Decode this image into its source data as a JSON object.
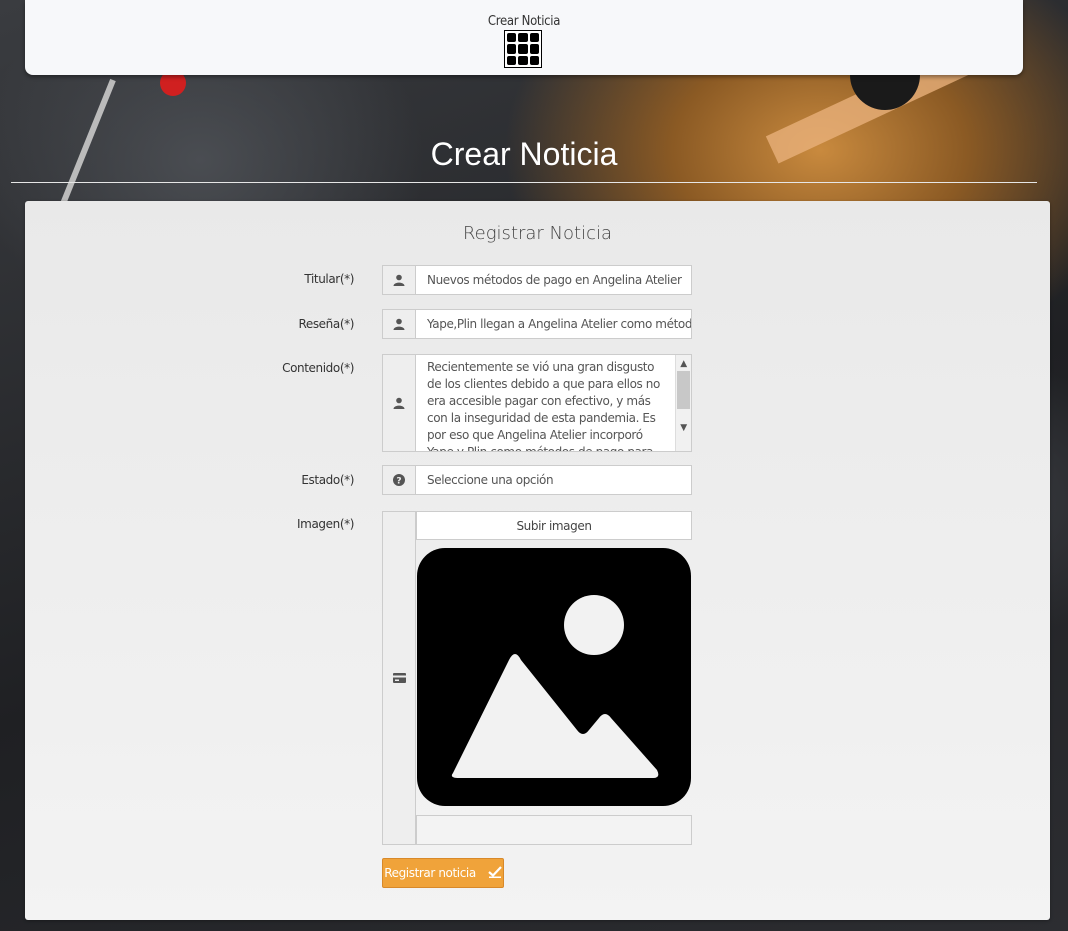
{
  "header": {
    "menu_title": "Crear Noticia",
    "menu_icon": "grid-icon"
  },
  "page": {
    "title": "Crear Noticia"
  },
  "form": {
    "title": "Registrar Noticia",
    "titular": {
      "label": "Titular(*)",
      "value": "Nuevos métodos de pago en Angelina Atelier",
      "icon": "user-icon"
    },
    "resena": {
      "label": "Reseña(*)",
      "value": "Yape,Plin llegan a Angelina Atelier como método",
      "icon": "user-icon"
    },
    "contenido": {
      "label": "Contenido(*)",
      "value": "Recientemente se vió una gran disgusto de los clientes debido a que para ellos no era accesible pagar con efectivo, y más con la inseguridad de esta pandemia. Es por eso que Angelina Atelier incorporó Yape y Plin como métodos de pago para la comodidad",
      "icon": "user-icon"
    },
    "estado": {
      "label": "Estado(*)",
      "value": "Seleccione una opción",
      "icon": "question-circle-icon"
    },
    "imagen": {
      "label": "Imagen(*)",
      "upload_label": "Subir imagen",
      "icon": "credit-card-icon"
    },
    "submit_label": "Registrar noticia",
    "submit_icon": "check-icon"
  },
  "colors": {
    "accent": "#f0a33a",
    "panel": "#eeeeee",
    "header": "#f7f8fa"
  }
}
